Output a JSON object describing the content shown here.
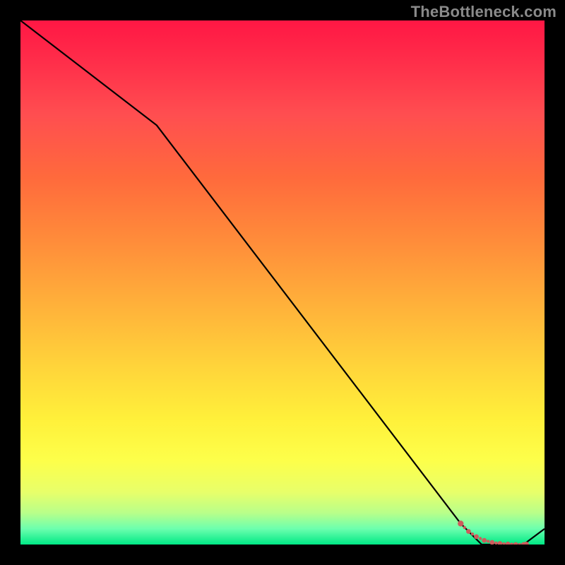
{
  "watermark": "TheBottleneck.com",
  "colors": {
    "frame": "#000000",
    "stroke_main": "#000000",
    "stroke_dots": "#cd5c5c",
    "grad_top": "#ff1744",
    "grad_bottom": "#00e985"
  },
  "chart_data": {
    "type": "line",
    "title": "",
    "xlabel": "",
    "ylabel": "",
    "xlim": [
      0,
      100
    ],
    "ylim": [
      0,
      100
    ],
    "x": [
      0,
      26,
      84,
      88,
      92,
      96,
      100
    ],
    "values": [
      100,
      80,
      4,
      0,
      0,
      0,
      3
    ],
    "highlight": {
      "style": "dotted",
      "color": "#cd5c5c",
      "x": [
        84,
        85.5,
        87,
        88.5,
        90,
        91.5,
        93,
        94.5,
        96
      ],
      "values": [
        4,
        2.5,
        1.5,
        0.8,
        0.4,
        0.2,
        0.1,
        0,
        0
      ]
    }
  }
}
